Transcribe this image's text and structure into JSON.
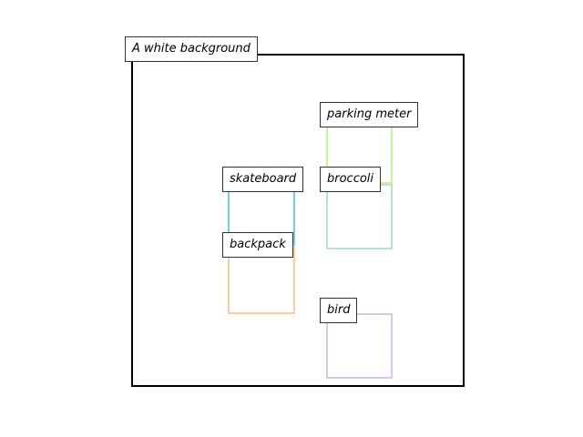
{
  "canvas": {
    "label": "A white background"
  },
  "objects": [
    {
      "id": "parking_meter",
      "label": "parking meter",
      "color": "#c9f29b"
    },
    {
      "id": "broccoli",
      "label": "broccoli",
      "color": "#bde3cc"
    },
    {
      "id": "skateboard",
      "label": "skateboard",
      "color": "#74cde0"
    },
    {
      "id": "backpack",
      "label": "backpack",
      "color": "#fccd9c"
    },
    {
      "id": "bird",
      "label": "bird",
      "color": "#d9c9e0"
    }
  ]
}
